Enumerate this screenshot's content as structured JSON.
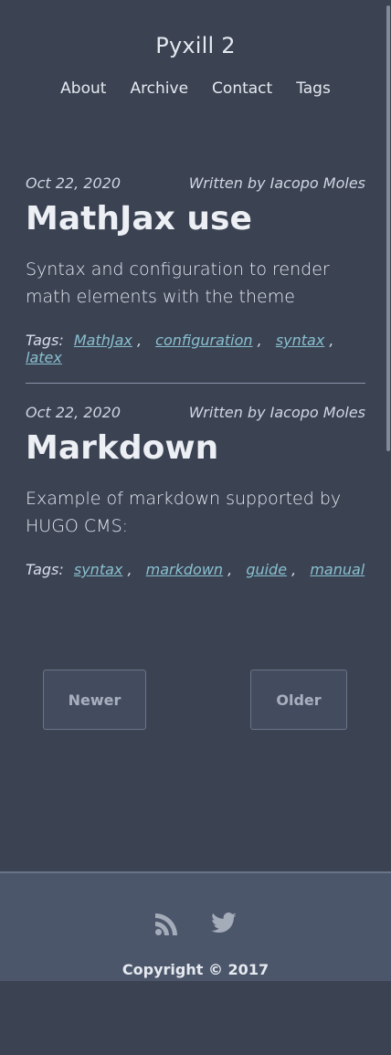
{
  "site": {
    "title": "Pyxill 2"
  },
  "nav": {
    "items": [
      "About",
      "Archive",
      "Contact",
      "Tags"
    ]
  },
  "posts": [
    {
      "date": "Oct 22, 2020",
      "author": "Written by Iacopo Moles",
      "title": "MathJax use",
      "summary": "Syntax and configuration to render math elements with the theme",
      "tags_label": "Tags:",
      "tags": [
        "MathJax",
        "configuration",
        "syntax",
        "latex"
      ]
    },
    {
      "date": "Oct 22, 2020",
      "author": "Written by Iacopo Moles",
      "title": "Markdown",
      "summary": "Example of markdown supported by HUGO CMS:",
      "tags_label": "Tags:",
      "tags": [
        "syntax",
        "markdown",
        "guide",
        "manual"
      ]
    }
  ],
  "pager": {
    "newer_label": "Newer",
    "older_label": "Older"
  },
  "footer": {
    "icons": [
      "rss-icon",
      "twitter-icon"
    ],
    "copyright": "Copyright © 2017"
  },
  "colors": {
    "background": "#3b4252",
    "footer": "#4c566a",
    "link": "#88c0d0",
    "text": "#e5e9f0"
  }
}
